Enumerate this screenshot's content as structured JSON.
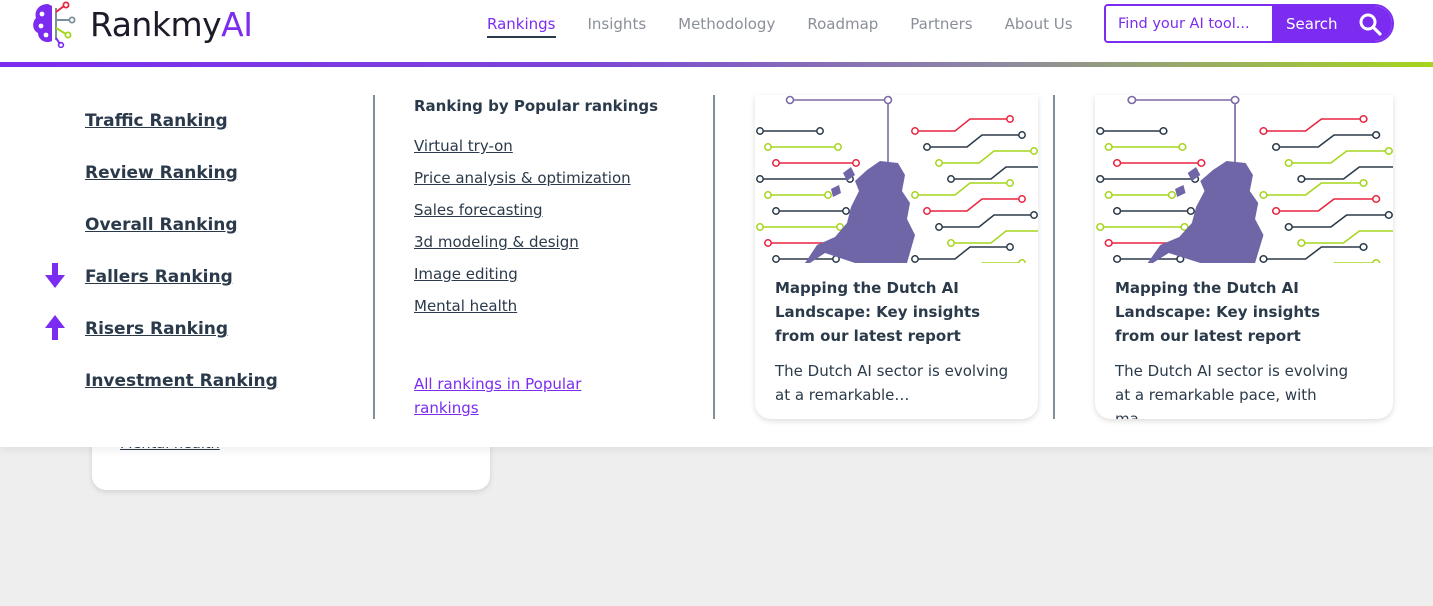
{
  "brand": {
    "logo_text_main": "Rankmy",
    "logo_text_accent": "AI",
    "accent_color": "#7c2cf0"
  },
  "nav": {
    "items": [
      "Rankings",
      "Insights",
      "Methodology",
      "Roadmap",
      "Partners",
      "About Us"
    ],
    "active": "Rankings"
  },
  "search": {
    "placeholder": "Find your AI tool...",
    "button_label": "Search"
  },
  "background_card": {
    "link_text": "Mental health"
  },
  "menu": {
    "rankings": [
      {
        "label": "Traffic Ranking",
        "icon": ""
      },
      {
        "label": "Review Ranking",
        "icon": ""
      },
      {
        "label": "Overall Ranking",
        "icon": ""
      },
      {
        "label": "Fallers Ranking",
        "icon": "arrow-down-icon"
      },
      {
        "label": "Risers Ranking",
        "icon": "arrow-up-icon"
      },
      {
        "label": "Investment Ranking",
        "icon": ""
      }
    ],
    "popular": {
      "title": "Ranking by Popular rankings",
      "items": [
        "Virtual try-on",
        "Price analysis & optimization",
        "Sales forecasting",
        "3d modeling & design",
        "Image editing",
        "Mental health"
      ],
      "all_link": "All rankings in Popular rankings"
    },
    "cards": [
      {
        "title": "Mapping the Dutch AI Landscape: Key insights from our latest report",
        "description": "The Dutch AI sector is evolving at a remarkable…"
      },
      {
        "title": "Mapping the Dutch AI Landscape: Key insights from our latest report",
        "description": "The Dutch AI sector is evolving at a remarkable pace, with ma…"
      }
    ]
  }
}
